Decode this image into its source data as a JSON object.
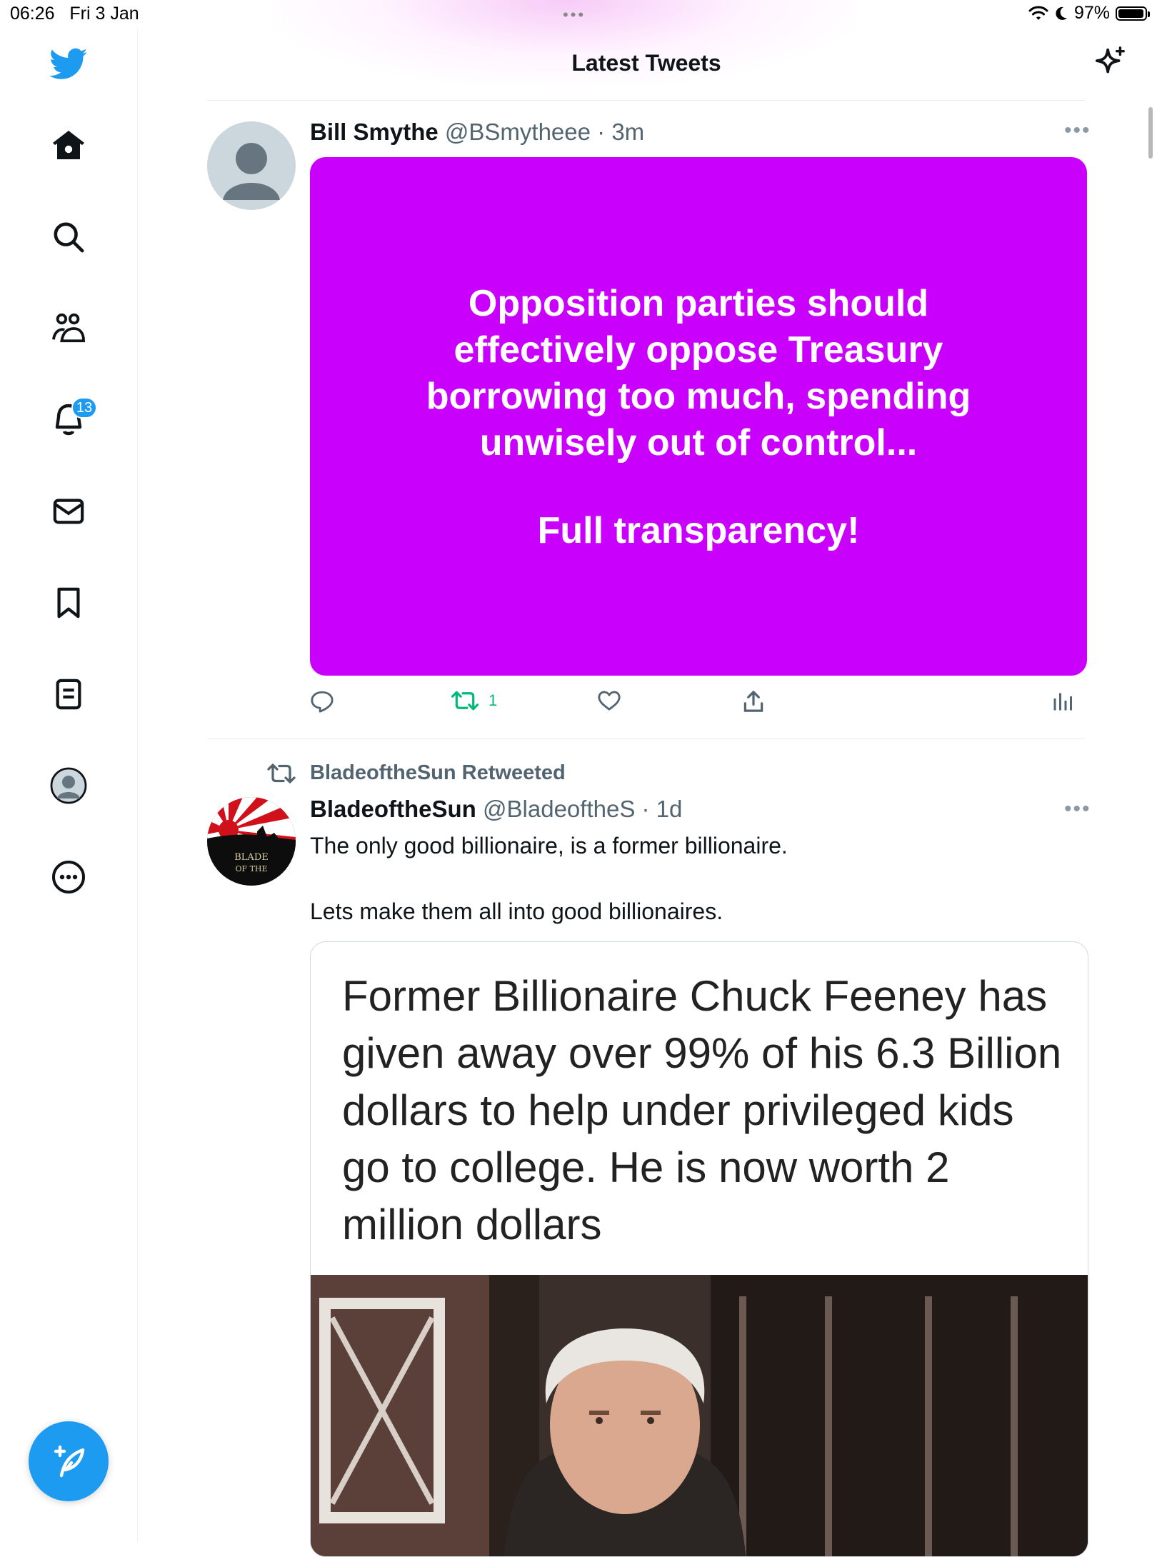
{
  "status_bar": {
    "time": "06:26",
    "date": "Fri 3 Jan",
    "battery": "97%",
    "battery_level": 0.97
  },
  "header": {
    "title": "Latest Tweets"
  },
  "sidebar": {
    "notifications_badge": "13",
    "items": [
      "home-icon",
      "search-icon",
      "communities-icon",
      "notifications-icon",
      "messages-icon",
      "bookmarks-icon",
      "lists-icon",
      "profile-icon",
      "more-icon"
    ]
  },
  "tweets": [
    {
      "name": "Bill Smythe",
      "handle": "@BSmytheee",
      "time": "· 3m",
      "card_text": "Opposition parties should effectively oppose Treasury borrowing too much, spending unwisely out of control...",
      "card_subtext": "Full transparency!",
      "card_color": "#c800fc",
      "retweets": "1"
    },
    {
      "retweet_label": "BladeoftheSun Retweeted",
      "name": "BladeoftheSun",
      "handle": "@BladeoftheS",
      "time": "· 1d",
      "text_line1": "The only good billionaire, is a former billionaire.",
      "text_line2": "Lets make them all into good billionaires.",
      "image_caption": "Former Billionaire Chuck Feeney has given away over 99% of his 6.3 Billion dollars to help under privileged kids go to college. He is now worth 2 million dollars",
      "avatar_text": "BLADE OF THE"
    }
  ],
  "colors": {
    "accent": "#1d9bf0",
    "retweet_green": "#00ba7c",
    "secondary_text": "#536471"
  }
}
